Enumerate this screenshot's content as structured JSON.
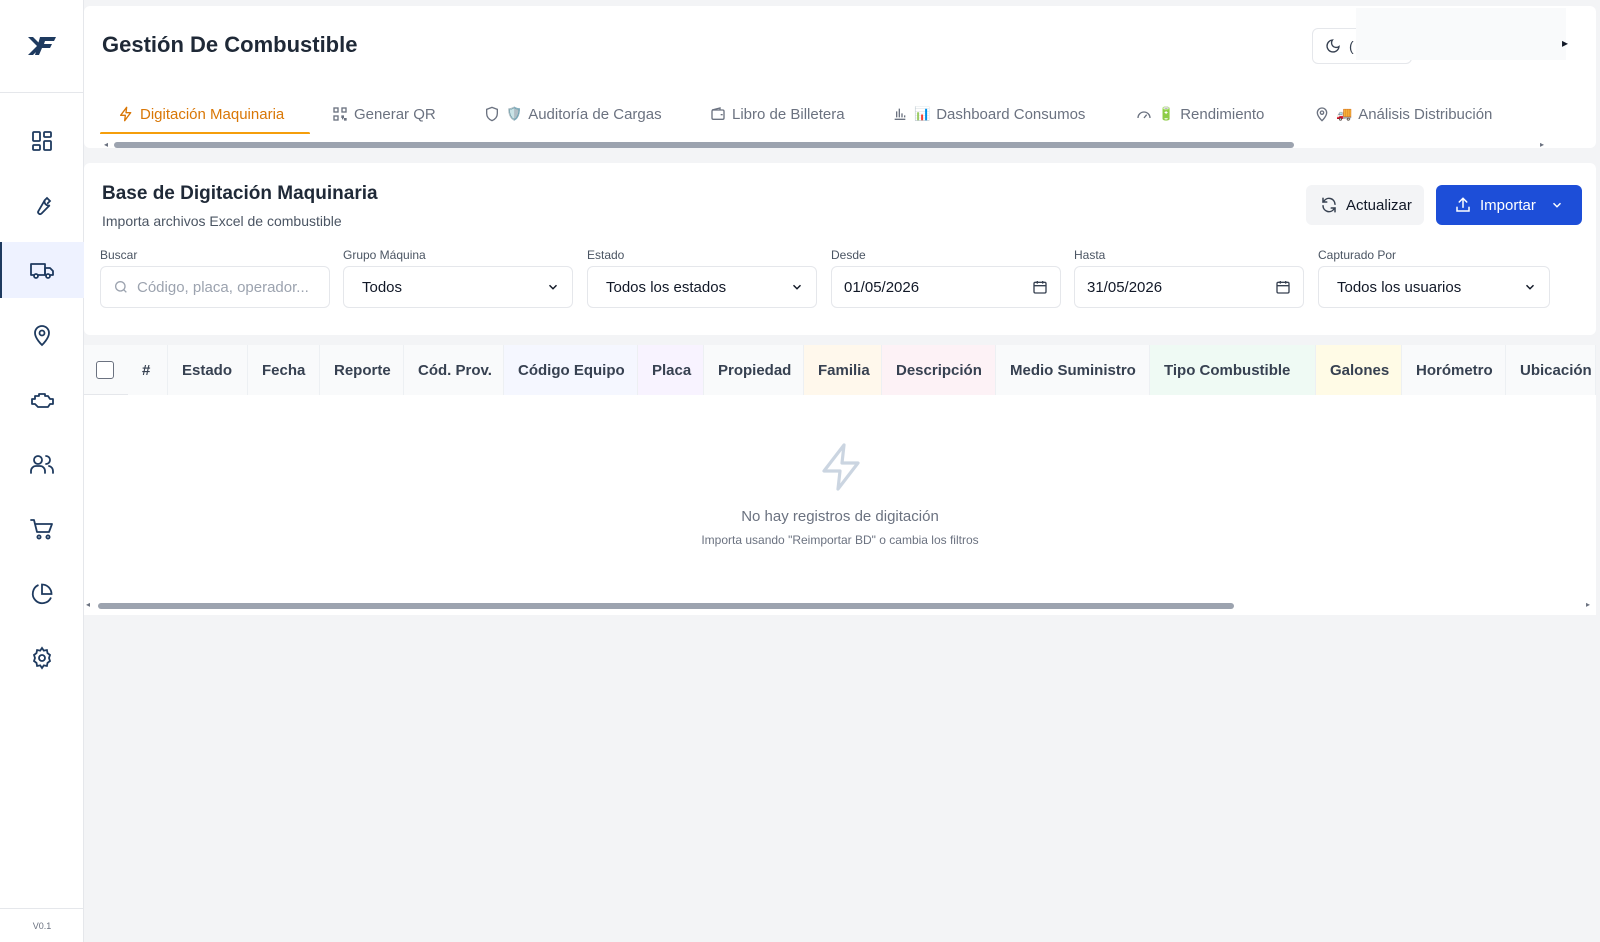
{
  "app": {
    "version": "V0.1",
    "logo_text": "XF"
  },
  "sidebar": {
    "items": [
      {
        "id": "dashboard",
        "icon": "grid-icon"
      },
      {
        "id": "maintenance",
        "icon": "wrench-icon"
      },
      {
        "id": "fuel",
        "icon": "truck-icon",
        "active": true
      },
      {
        "id": "locations",
        "icon": "map-pin-icon"
      },
      {
        "id": "engine",
        "icon": "engine-icon"
      },
      {
        "id": "users",
        "icon": "users-icon"
      },
      {
        "id": "shopping",
        "icon": "cart-icon"
      },
      {
        "id": "reports",
        "icon": "pie-chart-icon"
      },
      {
        "id": "settings",
        "icon": "gear-icon"
      }
    ]
  },
  "header": {
    "title": "Gestión De Combustible",
    "theme_icon": "moon-icon",
    "theme_label_partial": "("
  },
  "tabs": [
    {
      "label": "Digitación Maquinaria",
      "icon": "bolt-icon",
      "active": true
    },
    {
      "label": "Generar QR",
      "icon": "qr-icon"
    },
    {
      "label": "Auditoría de Cargas",
      "icon": "shield-icon",
      "emoji": "🛡️"
    },
    {
      "label": "Libro de Billetera",
      "icon": "wallet-icon"
    },
    {
      "label": "Dashboard Consumos",
      "icon": "bar-chart-icon",
      "emoji": "📊"
    },
    {
      "label": "Rendimiento",
      "icon": "gauge-icon",
      "emoji": "🔋"
    },
    {
      "label": "Análisis Distribución",
      "icon": "map-pin-icon",
      "emoji": "🚚"
    }
  ],
  "section": {
    "title": "Base de Digitación Maquinaria",
    "subtitle": "Importa archivos Excel de combustible",
    "refresh_label": "Actualizar",
    "import_label": "Importar"
  },
  "filters": {
    "search": {
      "label": "Buscar",
      "placeholder": "Código, placa, operador..."
    },
    "group": {
      "label": "Grupo Máquina",
      "value": "Todos"
    },
    "status": {
      "label": "Estado",
      "value": "Todos los estados"
    },
    "from": {
      "label": "Desde",
      "value": "01/05/2026"
    },
    "to": {
      "label": "Hasta",
      "value": "31/05/2026"
    },
    "captured_by": {
      "label": "Capturado Por",
      "value": "Todos los usuarios"
    }
  },
  "table": {
    "columns": [
      {
        "label": "#",
        "bg": "#f9fafb"
      },
      {
        "label": "Estado",
        "bg": "#f9fafb"
      },
      {
        "label": "Fecha",
        "bg": "#f9fafb"
      },
      {
        "label": "Reporte",
        "bg": "#f9fafb"
      },
      {
        "label": "Cód. Prov.",
        "bg": "#f9fafb"
      },
      {
        "label": "Código Equipo",
        "bg": "#f5f7ff"
      },
      {
        "label": "Placa",
        "bg": "#f8f3ff"
      },
      {
        "label": "Propiedad",
        "bg": "#f9fafb"
      },
      {
        "label": "Familia",
        "bg": "#fff8ec"
      },
      {
        "label": "Descripción",
        "bg": "#fdf2f6"
      },
      {
        "label": "Medio Suministro",
        "bg": "#f9fafb"
      },
      {
        "label": "Tipo Combustible",
        "bg": "#effaf4"
      },
      {
        "label": "Galones",
        "bg": "#fffbe6"
      },
      {
        "label": "Horómetro",
        "bg": "#f9fafb"
      },
      {
        "label": "Ubicación",
        "bg": "#f9fafb"
      }
    ],
    "empty_title": "No hay registros de digitación",
    "empty_subtitle": "Importa usando \"Reimportar BD\" o cambia los filtros"
  },
  "colors": {
    "accent": "#f59e0b",
    "primary": "#1d4ed8",
    "nav_icon": "#1e3a5f"
  }
}
